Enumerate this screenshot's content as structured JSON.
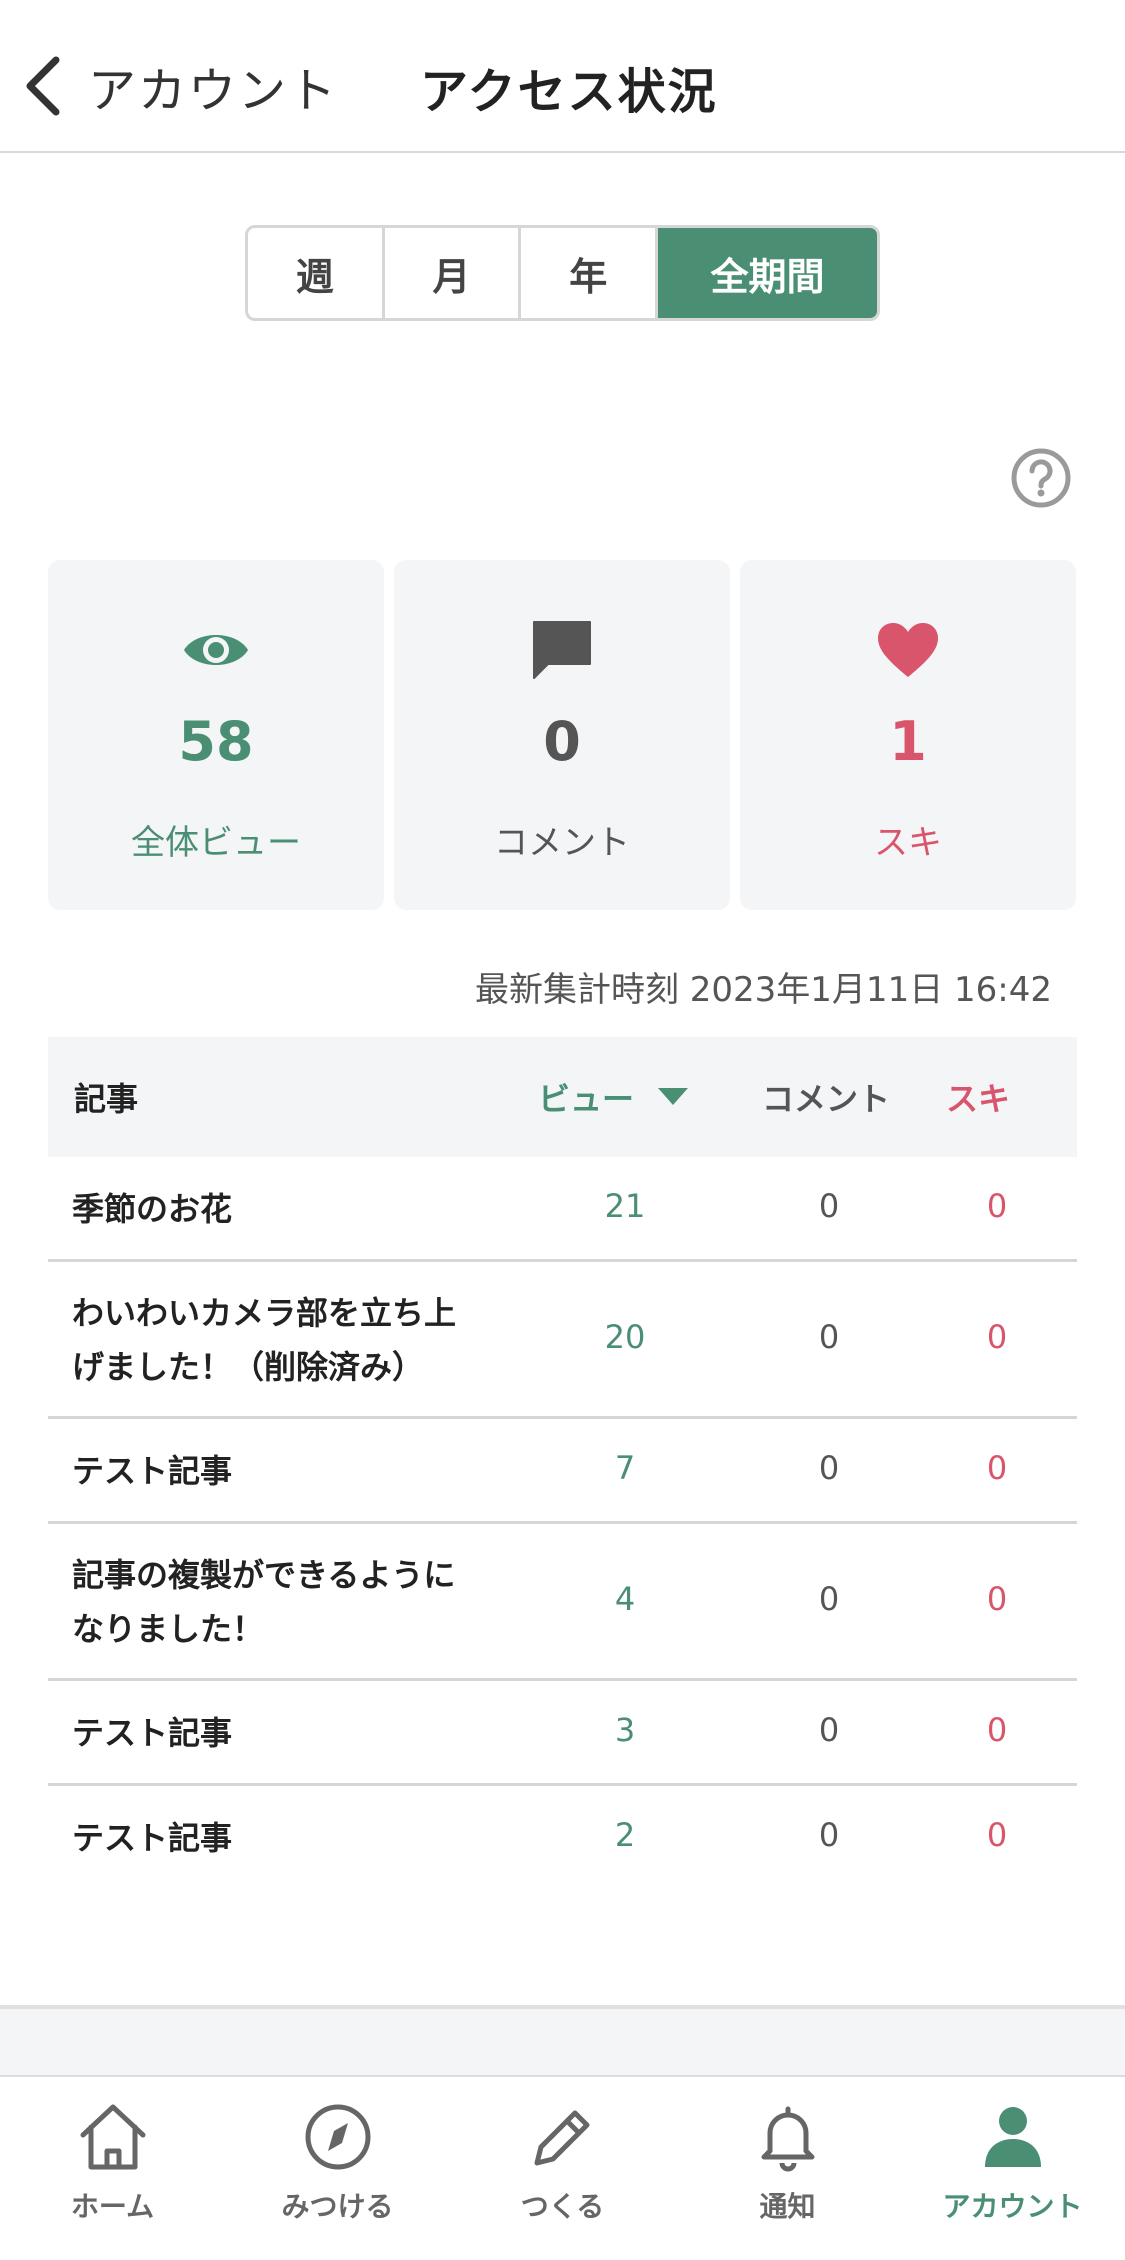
{
  "header": {
    "back_label": "アカウント",
    "title": "アクセス状況"
  },
  "period_tabs": [
    {
      "label": "週",
      "active": false
    },
    {
      "label": "月",
      "active": false
    },
    {
      "label": "年",
      "active": false
    },
    {
      "label": "全期間",
      "active": true
    }
  ],
  "stats": {
    "views": {
      "value": "58",
      "label": "全体ビュー",
      "icon": "eye-icon"
    },
    "comments": {
      "value": "0",
      "label": "コメント",
      "icon": "comment-icon"
    },
    "likes": {
      "value": "1",
      "label": "スキ",
      "icon": "heart-icon"
    }
  },
  "updated_text": "最新集計時刻 2023年1月11日 16:42",
  "table": {
    "headers": {
      "article": "記事",
      "views": "ビュー",
      "comments": "コメント",
      "likes": "スキ"
    },
    "rows": [
      {
        "title_line1": "季節のお花",
        "title_line2": "",
        "views": "21",
        "comments": "0",
        "likes": "0"
      },
      {
        "title_line1": "わいわいカメラ部を立ち上",
        "title_line2": "げました！（削除済み）",
        "views": "20",
        "comments": "0",
        "likes": "0"
      },
      {
        "title_line1": "テスト記事",
        "title_line2": "",
        "views": "7",
        "comments": "0",
        "likes": "0"
      },
      {
        "title_line1": "記事の複製ができるように",
        "title_line2": "なりました！",
        "views": "4",
        "comments": "0",
        "likes": "0"
      },
      {
        "title_line1": "テスト記事",
        "title_line2": "",
        "views": "3",
        "comments": "0",
        "likes": "0"
      },
      {
        "title_line1": "テスト記事",
        "title_line2": "",
        "views": "2",
        "comments": "0",
        "likes": "0"
      }
    ]
  },
  "bottom_nav": [
    {
      "label": "ホーム",
      "icon": "home-icon",
      "active": false
    },
    {
      "label": "みつける",
      "icon": "compass-icon",
      "active": false
    },
    {
      "label": "つくる",
      "icon": "pencil-icon",
      "active": false
    },
    {
      "label": "通知",
      "icon": "bell-icon",
      "active": false
    },
    {
      "label": "アカウント",
      "icon": "person-icon",
      "active": true
    }
  ],
  "colors": {
    "accent": "#4a8f74",
    "like": "#d9556b",
    "card_bg": "#f4f5f7"
  }
}
